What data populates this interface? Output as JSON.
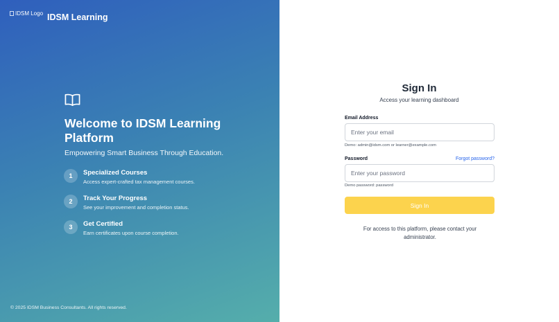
{
  "brand": {
    "logo_alt": "IDSM Logo",
    "name": "IDSM Learning"
  },
  "hero": {
    "icon": "book-open-icon",
    "headline": "Welcome to IDSM Learning Platform",
    "tagline": "Empowering Smart Business Through Education."
  },
  "features": [
    {
      "number": "1",
      "title": "Specialized Courses",
      "description": "Access expert-crafted tax management courses."
    },
    {
      "number": "2",
      "title": "Track Your Progress",
      "description": "See your improvement and completion status."
    },
    {
      "number": "3",
      "title": "Get Certified",
      "description": "Earn certificates upon course completion."
    }
  ],
  "footer": {
    "copyright": "© 2025 IDSM Business Consultants. All rights reserved."
  },
  "colors": {
    "gradient_start": "#2f5fbd",
    "gradient_end": "#55aeab",
    "button": "#fcd34d",
    "link": "#2563eb"
  },
  "signin": {
    "title": "Sign In",
    "subtitle": "Access your learning dashboard",
    "email_label": "Email Address",
    "email_placeholder": "Enter your email",
    "email_value": "",
    "email_hint": "Demo: admin@idsm.com or learner@example.com",
    "password_label": "Password",
    "forgot_label": "Forgot password?",
    "password_placeholder": "Enter your password",
    "password_value": "",
    "password_hint": "Demo password: password",
    "button_label": "Sign In",
    "contact_note": "For access to this platform, please contact your administrator."
  }
}
